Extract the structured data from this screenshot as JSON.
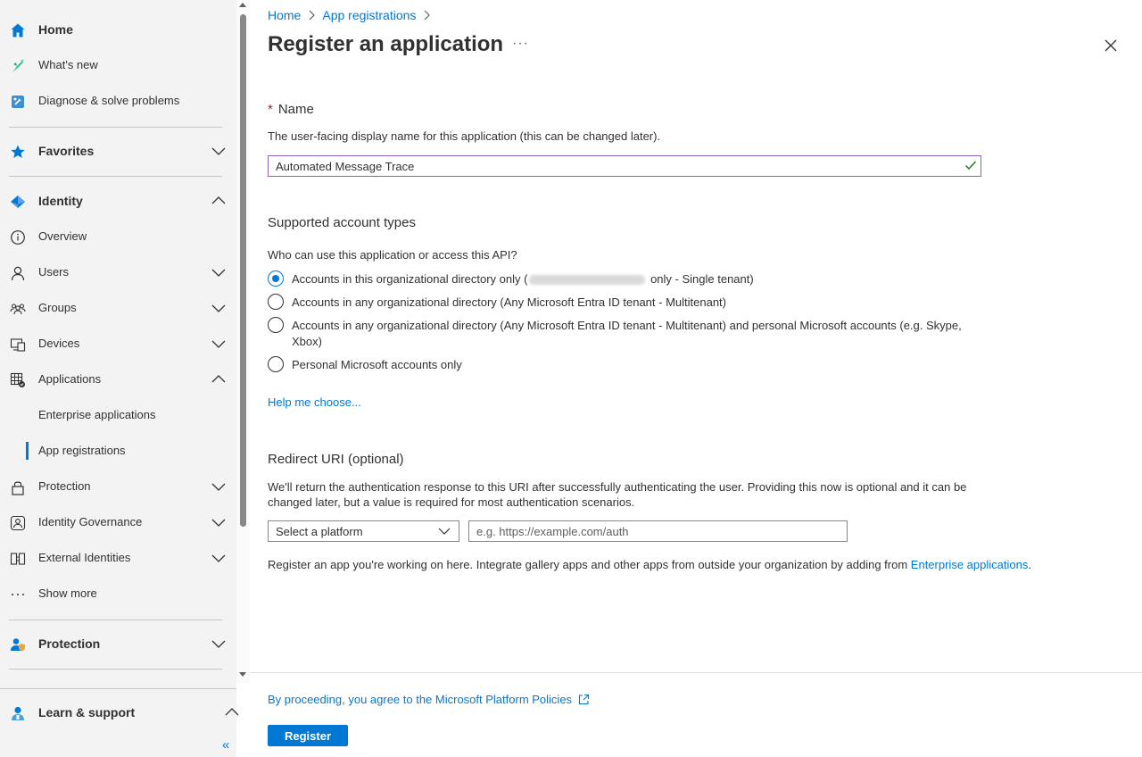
{
  "sidebar": {
    "home": "Home",
    "whats_new": "What's new",
    "diagnose": "Diagnose & solve problems",
    "favorites": "Favorites",
    "identity": "Identity",
    "overview": "Overview",
    "users": "Users",
    "groups": "Groups",
    "devices": "Devices",
    "applications": "Applications",
    "enterprise_apps": "Enterprise applications",
    "app_registrations": "App registrations",
    "protection_sub": "Protection",
    "identity_governance": "Identity Governance",
    "external_identities": "External Identities",
    "show_more": "Show more",
    "protection": "Protection",
    "learn_support": "Learn & support",
    "collapse_glyph": "«"
  },
  "breadcrumb": {
    "home": "Home",
    "app_registrations": "App registrations",
    "separator": ">"
  },
  "page": {
    "title": "Register an application",
    "more": "···"
  },
  "name_section": {
    "required_marker": "*",
    "title": "Name",
    "help": "The user-facing display name for this application (this can be changed later).",
    "value": "Automated Message Trace"
  },
  "accounts_section": {
    "title": "Supported account types",
    "question": "Who can use this application or access this API?",
    "options": [
      {
        "before": "Accounts in this organizational directory only (",
        "after": " only - Single tenant)",
        "selected": true
      },
      {
        "label": "Accounts in any organizational directory (Any Microsoft Entra ID tenant - Multitenant)",
        "selected": false
      },
      {
        "label": "Accounts in any organizational directory (Any Microsoft Entra ID tenant - Multitenant) and personal Microsoft accounts (e.g. Skype, Xbox)",
        "selected": false
      },
      {
        "label": "Personal Microsoft accounts only",
        "selected": false
      }
    ],
    "help_link": "Help me choose..."
  },
  "redirect_section": {
    "title": "Redirect URI (optional)",
    "help": "We'll return the authentication response to this URI after successfully authenticating the user. Providing this now is optional and it can be changed later, but a value is required for most authentication scenarios.",
    "platform_placeholder": "Select a platform",
    "uri_placeholder": "e.g. https://example.com/auth",
    "gallery_text": "Register an app you're working on here. Integrate gallery apps and other apps from outside your organization by adding from ",
    "gallery_link": "Enterprise applications",
    "gallery_end": "."
  },
  "footer": {
    "policy_link": "By proceeding, you agree to the Microsoft Platform Policies",
    "register_label": "Register"
  },
  "colors": {
    "accent": "#0078d4",
    "input_focus": "#8764b8",
    "valid_check": "#107c10",
    "required": "#a4262c"
  }
}
